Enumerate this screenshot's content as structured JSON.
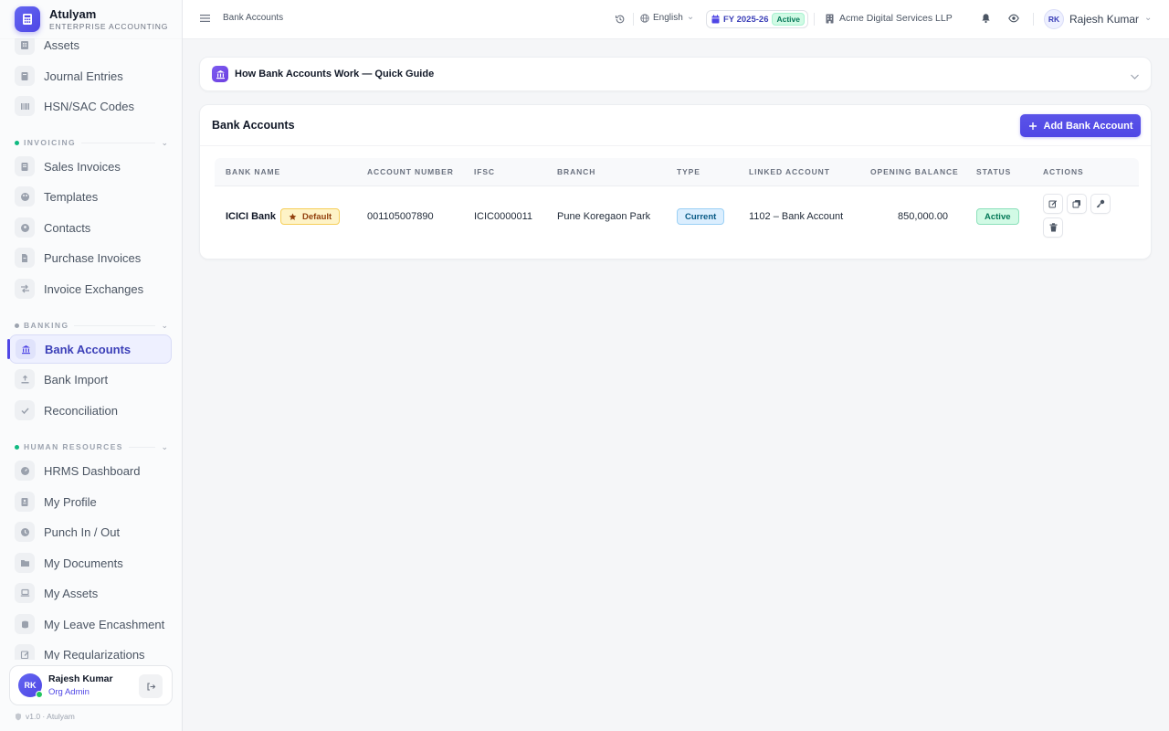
{
  "app": {
    "name": "Atulyam",
    "subtitle": "ENTERPRISE ACCOUNTING",
    "version": "v1.0 · Atulyam"
  },
  "sidebar": {
    "items_top": [
      {
        "label": "Assets",
        "icon": "building-icon"
      },
      {
        "label": "Journal Entries",
        "icon": "book-icon"
      },
      {
        "label": "HSN/SAC Codes",
        "icon": "barcode-icon"
      }
    ],
    "sections": {
      "invoicing": "INVOICING",
      "banking": "BANKING",
      "hr": "HUMAN RESOURCES"
    },
    "invoicing_items": [
      "Sales Invoices",
      "Templates",
      "Contacts",
      "Purchase Invoices",
      "Invoice Exchanges"
    ],
    "banking_items": [
      "Bank Accounts",
      "Bank Import",
      "Reconciliation"
    ],
    "hr_items": [
      "HRMS Dashboard",
      "My Profile",
      "Punch In / Out",
      "My Documents",
      "My Assets",
      "My Leave Encashment",
      "My Regularizations"
    ]
  },
  "user": {
    "initials": "RK",
    "name": "Rajesh Kumar",
    "role": "Org Admin"
  },
  "topbar": {
    "breadcrumb": "Bank Accounts",
    "language": "English",
    "fiscal_year": "FY 2025-26",
    "fy_status": "Active",
    "organization": "Acme Digital Services LLP",
    "user_initials": "RK",
    "user_name": "Rajesh Kumar"
  },
  "guide": {
    "title": "How Bank Accounts Work — Quick Guide"
  },
  "panel": {
    "title": "Bank Accounts",
    "add_button": "Add Bank Account",
    "columns": [
      "BANK NAME",
      "ACCOUNT NUMBER",
      "IFSC",
      "BRANCH",
      "TYPE",
      "LINKED ACCOUNT",
      "OPENING BALANCE",
      "STATUS",
      "ACTIONS"
    ],
    "rows": [
      {
        "bank_name": "ICICI Bank",
        "default_badge": "Default",
        "account_number": "001105007890",
        "ifsc": "ICIC0000011",
        "branch": "Pune Koregaon Park",
        "type": "Current",
        "linked_account": "1102 – Bank Account",
        "opening_balance": "850,000.00",
        "status": "Active"
      }
    ]
  },
  "colors": {
    "accent": "#4f46e5",
    "active_green": "#047857",
    "default_yellow": "#fef3c7"
  }
}
